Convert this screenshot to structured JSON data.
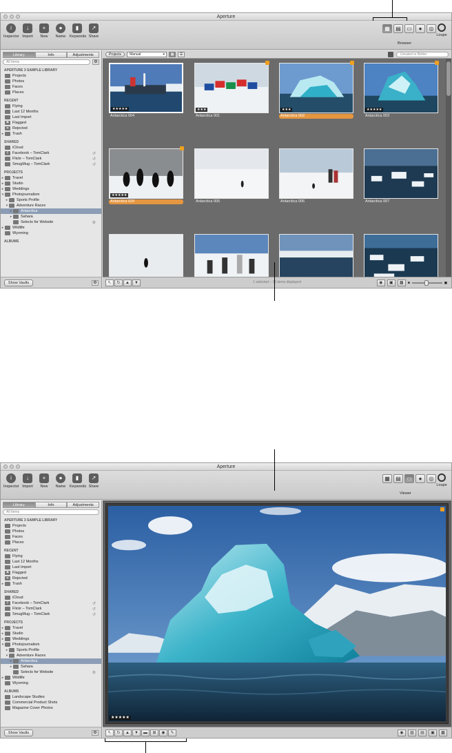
{
  "app_title": "Aperture",
  "toolbar": {
    "buttons": [
      "Inspector",
      "Import",
      "New",
      "Name",
      "Keywords",
      "Share"
    ],
    "browser_label": "Browser",
    "viewer_label": "Viewer",
    "loupe_label": "Loupe"
  },
  "sidebar": {
    "tabs": [
      "Library",
      "Info",
      "Adjustments"
    ],
    "search_placeholder": "All Items",
    "lib_header": "APERTURE 3 SAMPLE LIBRARY",
    "lib_items": [
      "Projects",
      "Photos",
      "Faces",
      "Places"
    ],
    "recent_header": "RECENT",
    "recent_items": [
      "Flying",
      "Last 12 Months",
      "Last Import",
      "Flagged",
      "Rejected",
      "Trash"
    ],
    "shared_header": "SHARED",
    "shared_items": [
      "iCloud",
      "Facebook – TomClark",
      "Flickr – TomClark",
      "SmugMug – TomClark"
    ],
    "projects_header": "PROJECTS",
    "project_items": [
      "Travel",
      "Studio",
      "Weddings",
      "Photojournalism",
      "Sports Profile",
      "Adventure Races",
      "Antarctica",
      "Sahara",
      "Selects for Website",
      "Wildlife",
      "Wyoming"
    ],
    "albums_header": "ALBUMS",
    "album_items": [
      "Landscape Studies",
      "Commercial Product Shots",
      "Magazine Cover Photos"
    ],
    "show_vaults": "Show Vaults"
  },
  "browser": {
    "projects_btn": "Projects",
    "sort": "Manual",
    "filter_placeholder": "Unrated or Better",
    "status": "1 selected – 16 items displayed",
    "thumbs": [
      {
        "label": "Antarctica 004",
        "stars": "★★★★★",
        "badge": false,
        "hl": false
      },
      {
        "label": "Antarctica 001",
        "stars": "★★★",
        "badge": true,
        "hl": false
      },
      {
        "label": "Antarctica 002",
        "stars": "★★★",
        "badge": true,
        "hl": true
      },
      {
        "label": "Antarctica 003",
        "stars": "★★★★★",
        "badge": true,
        "hl": false
      },
      {
        "label": "Antarctica 029",
        "stars": "★★★★★",
        "badge": true,
        "hl": true
      },
      {
        "label": "Antarctica 005",
        "stars": "",
        "badge": false,
        "hl": false
      },
      {
        "label": "Antarctica 006",
        "stars": "",
        "badge": false,
        "hl": false
      },
      {
        "label": "Antarctica 007",
        "stars": "",
        "badge": false,
        "hl": false
      },
      {
        "label": "",
        "stars": "★★★",
        "badge": false,
        "hl": false
      },
      {
        "label": "",
        "stars": "",
        "badge": false,
        "hl": false
      },
      {
        "label": "",
        "stars": "",
        "badge": false,
        "hl": false
      },
      {
        "label": "",
        "stars": "★★★",
        "badge": false,
        "hl": false
      }
    ]
  },
  "viewer": {
    "stars": "★★★★★"
  }
}
